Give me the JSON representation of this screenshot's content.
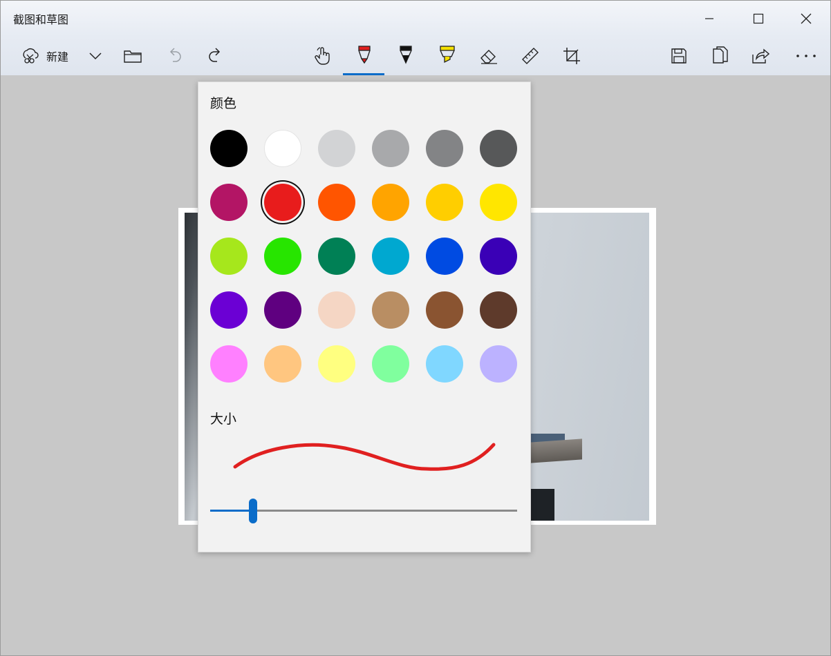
{
  "window": {
    "title": "截图和草图"
  },
  "toolbar": {
    "new_label": "新建",
    "tools": [
      {
        "name": "touch-writing-icon"
      },
      {
        "name": "ballpoint-pen-icon",
        "color": "#e02020",
        "active": true
      },
      {
        "name": "pencil-icon"
      },
      {
        "name": "highlighter-icon",
        "color": "#f4e000"
      },
      {
        "name": "eraser-icon"
      },
      {
        "name": "ruler-icon"
      },
      {
        "name": "crop-icon"
      }
    ],
    "active_accent": "#0a6cc9"
  },
  "pen_panel": {
    "color_label": "颜色",
    "size_label": "大小",
    "selected_color": "#e81c1c",
    "colors": [
      "#000000",
      "#ffffff",
      "#d2d3d5",
      "#a8a9ab",
      "#838486",
      "#575859",
      "#b31565",
      "#e81c1c",
      "#ff5500",
      "#ffa400",
      "#ffce00",
      "#ffe600",
      "#a6e71c",
      "#27e500",
      "#008055",
      "#00a8d0",
      "#004be2",
      "#3a00b6",
      "#6b00d4",
      "#5f0080",
      "#f5d6c4",
      "#b98e63",
      "#8a5431",
      "#5e3a2b",
      "#ff80ff",
      "#ffc680",
      "#ffff80",
      "#80ff9e",
      "#80d7ff",
      "#bcb2ff"
    ],
    "stroke_color": "#e02020",
    "size_value": 0.14
  }
}
